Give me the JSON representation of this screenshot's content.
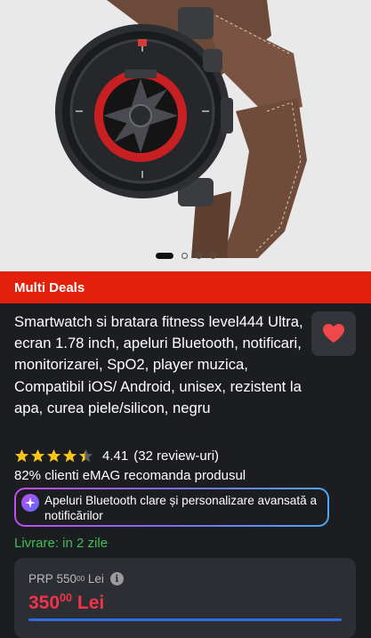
{
  "gallery": {
    "product_image_alt": "Smartwatch with brown leather strap",
    "pagination_count": 4,
    "active_index": 0
  },
  "deals": {
    "label": "Multi Deals"
  },
  "product": {
    "title": "Smartwatch si bratara fitness level444 Ultra, ecran 1.78 inch, apeluri Bluetooth, notificari, monitorizarei, SpO2, player muzica, Compatibil iOS/ Android, unisex, rezistent la apa, curea piele/silicon, negru",
    "rating_value": 4.41,
    "rating_text": "4.41",
    "reviews_text": "(32 review-uri)",
    "recommend_text": "82% clienti eMAG recomanda produsul",
    "ai_summary": "Apeluri Bluetooth clare și personalizare avansată a notificărilor",
    "delivery_text": "Livrare: in 2 zile"
  },
  "pricing": {
    "prp_label": "PRP",
    "prp_int": "550",
    "prp_dec": "00",
    "prp_currency": "Lei",
    "price_int": "350",
    "price_dec": "00",
    "price_currency": "Lei"
  },
  "icons": {
    "favorite": "heart-icon",
    "ai": "sparkle-icon",
    "info": "info-icon",
    "star": "star-icon"
  },
  "colors": {
    "accent_red": "#e3210b",
    "price_red": "#f2334a",
    "delivery_green": "#3fbf58",
    "star_yellow": "#f5c518",
    "background": "#1c1d20"
  }
}
